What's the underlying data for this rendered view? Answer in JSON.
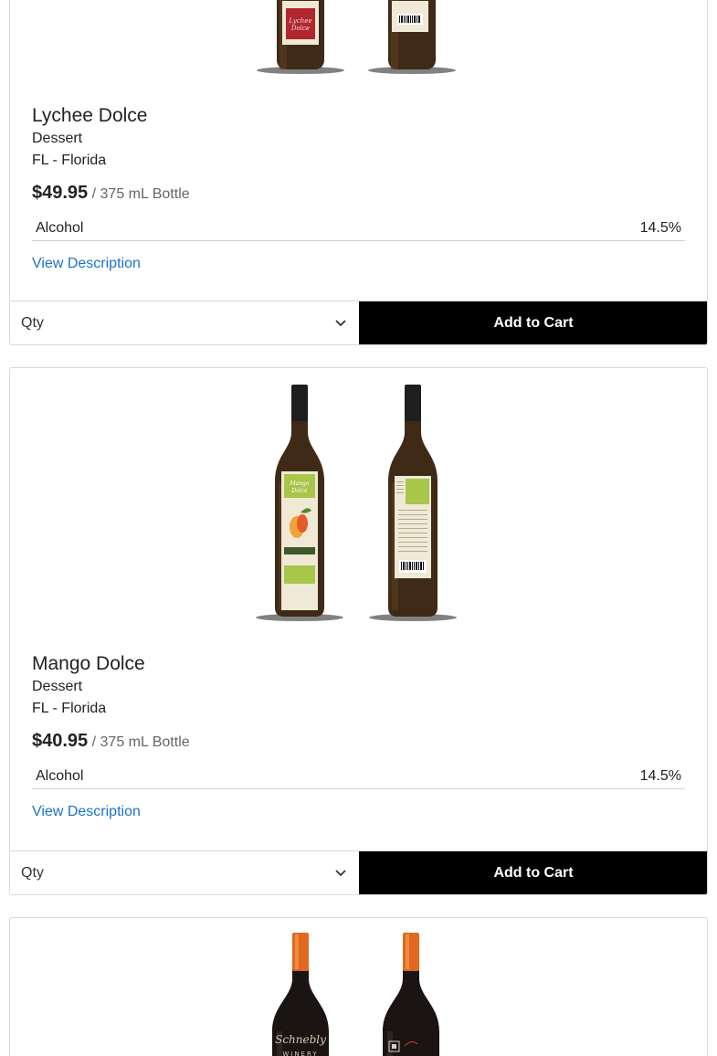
{
  "products": [
    {
      "name": "Lychee Dolce",
      "type": "Dessert",
      "region": "FL - Florida",
      "price": "$49.95",
      "unit": "/ 375 mL Bottle",
      "spec_label": "Alcohol",
      "spec_value": "14.5%",
      "view_description": "View Description",
      "qty_label": "Qty",
      "add_to_cart": "Add to Cart",
      "label_color": "#b2262e"
    },
    {
      "name": "Mango Dolce",
      "type": "Dessert",
      "region": "FL - Florida",
      "price": "$40.95",
      "unit": "/ 375 mL Bottle",
      "spec_label": "Alcohol",
      "spec_value": "14.5%",
      "view_description": "View Description",
      "qty_label": "Qty",
      "add_to_cart": "Add to Cart",
      "label_color": "#a8c64a"
    },
    {
      "capsule_color": "#e0691f"
    }
  ],
  "colors": {
    "link": "#1a73c8",
    "button_bg": "#000000",
    "button_text": "#ffffff"
  }
}
